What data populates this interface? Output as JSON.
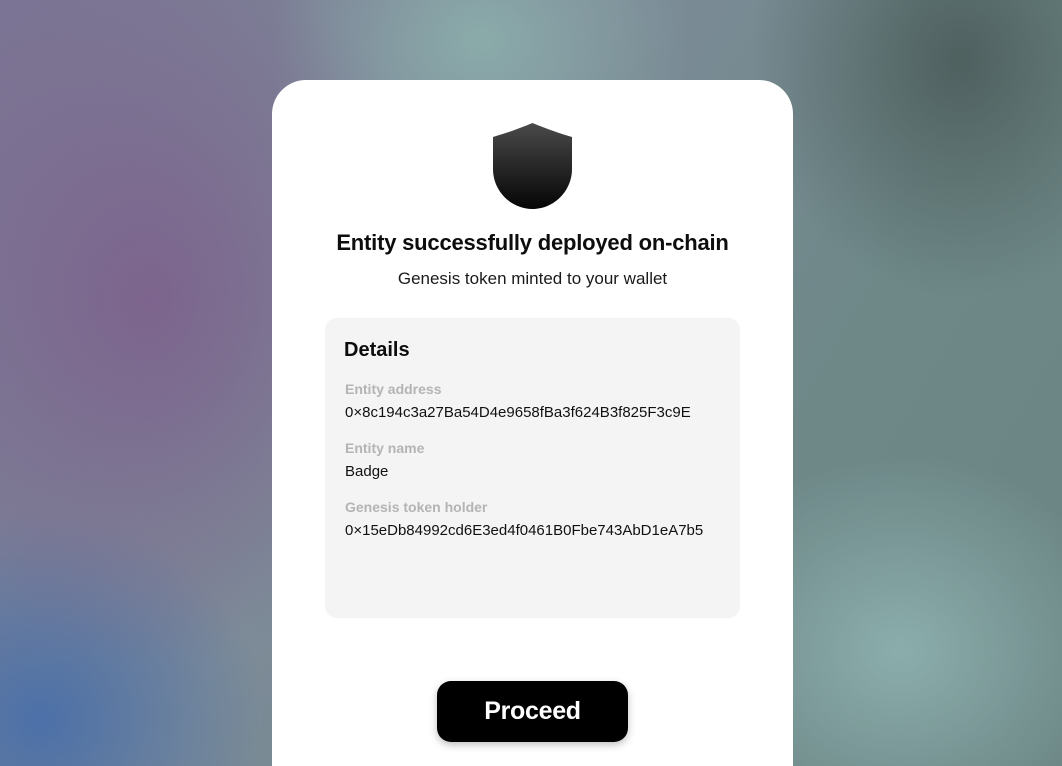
{
  "dialog": {
    "icon": "shield-icon",
    "title": "Entity successfully deployed on-chain",
    "subtitle": "Genesis token minted to your wallet",
    "details": {
      "heading": "Details",
      "fields": [
        {
          "label": "Entity address",
          "value": "0×8c194c3a27Ba54D4e9658fBa3f624B3f825F3c9E"
        },
        {
          "label": "Entity name",
          "value": "Badge"
        },
        {
          "label": "Genesis token holder",
          "value": "0×15eDb84992cd6E3ed4f0461B0Fbe743AbD1eA7b5"
        }
      ]
    },
    "proceed_label": "Proceed"
  },
  "colors": {
    "card_background": "#ffffff",
    "details_background": "#f4f4f4",
    "label_color": "#b4b4b4",
    "button_background": "#000000",
    "button_text": "#ffffff"
  }
}
